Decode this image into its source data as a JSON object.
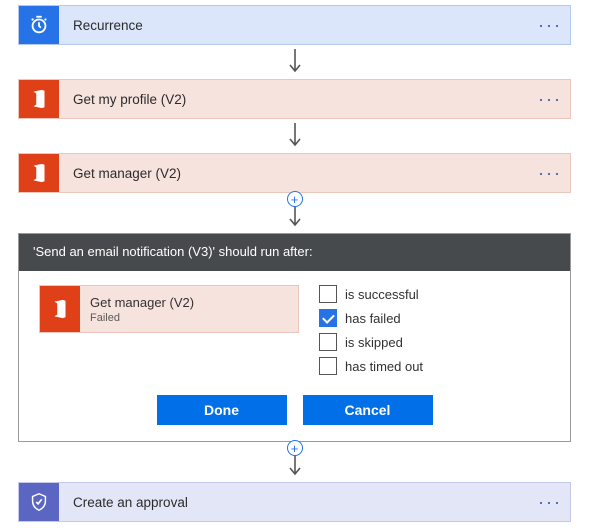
{
  "steps": {
    "recurrence_title": "Recurrence",
    "getprofile_title": "Get my profile (V2)",
    "getmanager_title": "Get manager (V2)",
    "approval_title": "Create an approval"
  },
  "panel": {
    "header": "'Send an email notification (V3)' should run after:",
    "dep_title": "Get manager (V2)",
    "dep_status": "Failed",
    "options": {
      "is_successful": {
        "label": "is successful",
        "checked": false
      },
      "has_failed": {
        "label": "has failed",
        "checked": true
      },
      "is_skipped": {
        "label": "is skipped",
        "checked": false
      },
      "has_timed_out": {
        "label": "has timed out",
        "checked": false
      }
    },
    "buttons": {
      "done": "Done",
      "cancel": "Cancel"
    }
  },
  "chart_data": {
    "type": "table",
    "note": "not a chart"
  }
}
